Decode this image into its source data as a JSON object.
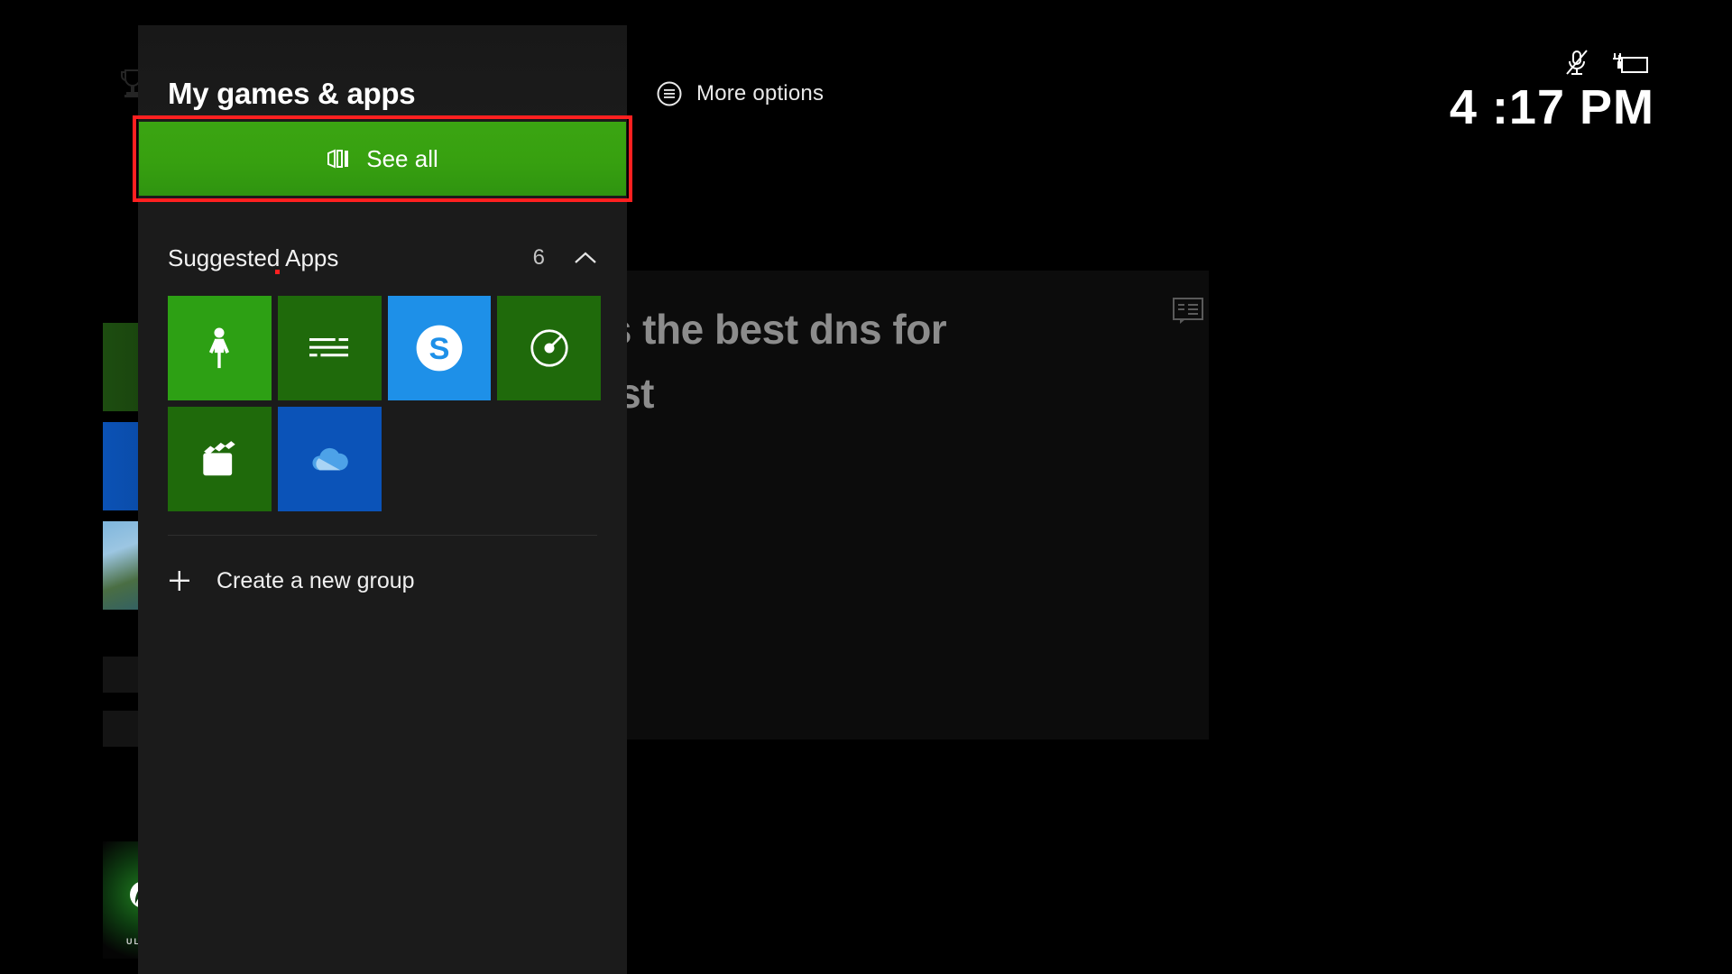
{
  "topbar": {
    "more_options_label": "More options",
    "more_options_icon": "hamburger-circle-icon",
    "clock": "4 :17 PM",
    "status": [
      {
        "icon": "microphone-muted-icon",
        "name": "mic-muted"
      },
      {
        "icon": "battery-charging-icon",
        "name": "battery-charging"
      }
    ]
  },
  "background": {
    "headline": "ts the best dns for\nast",
    "message_icon": "message-badge-icon",
    "rail": {
      "trophy_icon": "trophy-icon",
      "gamepass_label": "ULT",
      "gamepass_icon": "xbox-sphere-icon"
    }
  },
  "panel": {
    "title": "My games & apps",
    "see_all": {
      "label": "See all",
      "icon": "apps-grid-icon",
      "highlight_color": "#ff2020",
      "background_color": "#37a010",
      "focused": true
    },
    "section": {
      "title": "Suggested Apps",
      "count": "6",
      "chevron": "chevron-up-icon",
      "expanded": true
    },
    "tiles": [
      {
        "name": "avatar-editor",
        "icon": "person-avatar-icon",
        "color": "#2da014"
      },
      {
        "name": "text-app",
        "icon": "lines-list-icon",
        "color": "#1f6a0b"
      },
      {
        "name": "skype",
        "icon": "skype-s-icon",
        "color": "#1e90e8"
      },
      {
        "name": "blu-ray-player",
        "icon": "disc-icon",
        "color": "#1f6a0b"
      },
      {
        "name": "movies-and-tv",
        "icon": "clapperboard-icon",
        "color": "#1f6a0b"
      },
      {
        "name": "onedrive",
        "icon": "cloud-icon",
        "color": "#0b53b8"
      }
    ],
    "create_group": {
      "label": "Create a new group",
      "icon": "plus-icon"
    }
  }
}
